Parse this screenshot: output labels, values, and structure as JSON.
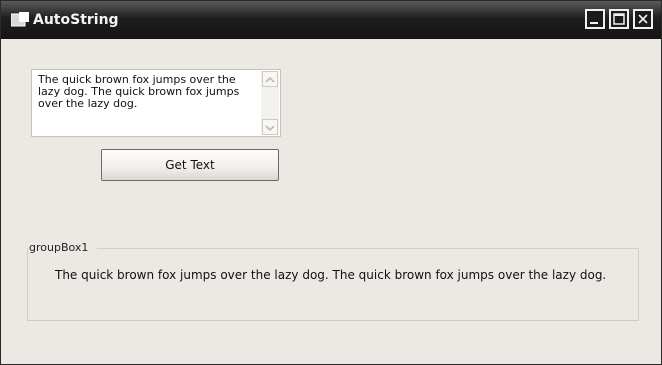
{
  "window": {
    "title": "AutoString",
    "controls": {
      "minimize": "minimize",
      "maximize": "maximize",
      "close": "close"
    }
  },
  "input": {
    "text": "The quick brown fox jumps over the lazy dog. The quick brown fox jumps over the lazy dog."
  },
  "get_text_button": {
    "label": "Get Text"
  },
  "group": {
    "title": "groupBox1",
    "result_text": "The quick brown fox jumps over the lazy dog. The quick brown fox jumps over the lazy dog."
  }
}
